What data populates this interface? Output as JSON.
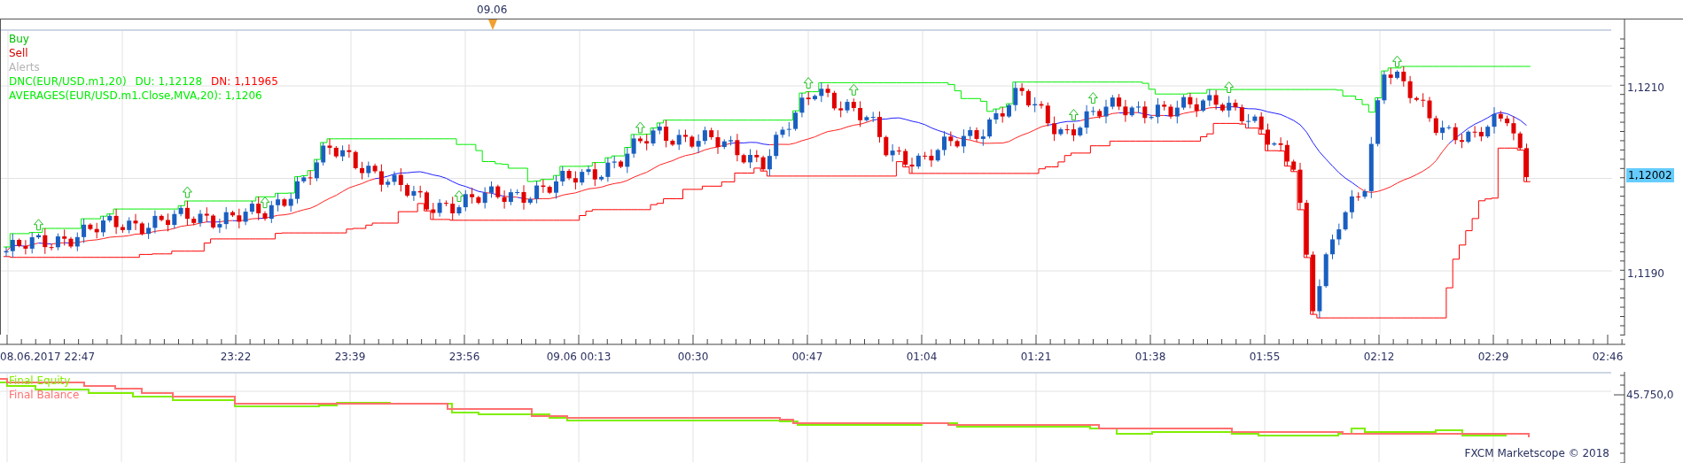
{
  "header": {
    "date_marker": "09.06"
  },
  "legend": [
    {
      "text": "Buy",
      "color": "#00c000"
    },
    {
      "text": "Sell",
      "color": "#d00000"
    },
    {
      "text": "Alerts",
      "color": "#b4b4b4"
    }
  ],
  "indicator_lines": [
    {
      "parts": [
        {
          "text": "DNC(EUR/USD.m1,20)",
          "color": "#00ee00"
        },
        {
          "text": "DU: 1,12128",
          "color": "#00ee00"
        },
        {
          "text": "DN: 1,11965",
          "color": "#ff0000"
        }
      ]
    },
    {
      "parts": [
        {
          "text": "AVERAGES(EUR/USD.m1.Close,MVA,20): 1,1206",
          "color": "#00ee00"
        }
      ]
    }
  ],
  "price_axis": {
    "labels": [
      "1,1210",
      "1,1190"
    ],
    "current_price": "1,12002"
  },
  "time_axis": {
    "labels": [
      "08.06.2017 22:47",
      "23:22",
      "23:39",
      "23:56",
      "09.06 00:13",
      "00:30",
      "00:47",
      "01:04",
      "01:21",
      "01:38",
      "01:55",
      "02:12",
      "02:29",
      "02:46"
    ]
  },
  "equity_panel": {
    "legend": [
      {
        "text": "Final Equity",
        "color": "#80ee00"
      },
      {
        "text": "Final Balance",
        "color": "#ff7070"
      }
    ],
    "axis_label": "45.750,0"
  },
  "copyright": "FXCM Marketscope © 2018"
}
